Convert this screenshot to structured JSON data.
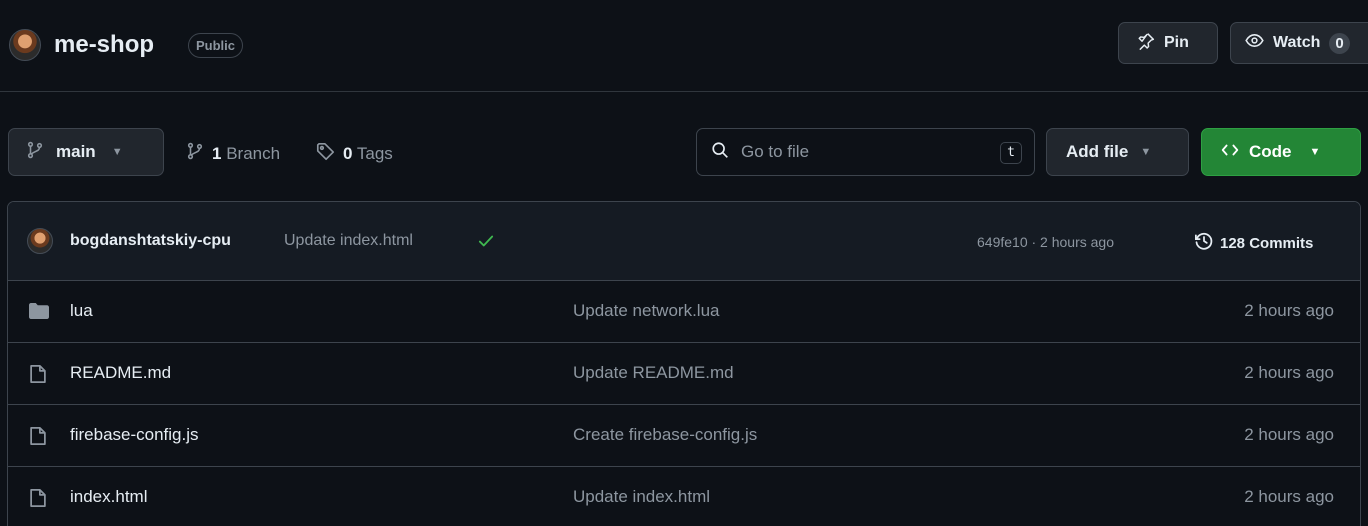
{
  "repo": {
    "name": "me-shop",
    "visibility": "Public",
    "pin_label": "Pin",
    "watch_label": "Watch",
    "watch_count": "0"
  },
  "toolbar": {
    "branch": "main",
    "branch_count": "1",
    "branch_label": "Branch",
    "tag_count": "0",
    "tag_label": "Tags",
    "search_placeholder": "Go to file",
    "search_shortcut": "t",
    "add_file_label": "Add file",
    "code_label": "Code"
  },
  "latest_commit": {
    "author": "bogdanshtatskiy-cpu",
    "message": "Update index.html",
    "sha_time": "649fe10 · 2 hours ago",
    "commits_label": "128 Commits"
  },
  "files": [
    {
      "name": "lua",
      "type": "folder",
      "commit": "Update network.lua",
      "time": "2 hours ago"
    },
    {
      "name": "README.md",
      "type": "file",
      "commit": "Update README.md",
      "time": "2 hours ago"
    },
    {
      "name": "firebase-config.js",
      "type": "file",
      "commit": "Create firebase-config.js",
      "time": "2 hours ago"
    },
    {
      "name": "index.html",
      "type": "file",
      "commit": "Update index.html",
      "time": "2 hours ago"
    }
  ],
  "colors": {
    "background": "#0d1117",
    "border": "#3d444d",
    "code_button": "#238636",
    "success_check": "#3fb950",
    "muted_text": "#8d96a0"
  }
}
